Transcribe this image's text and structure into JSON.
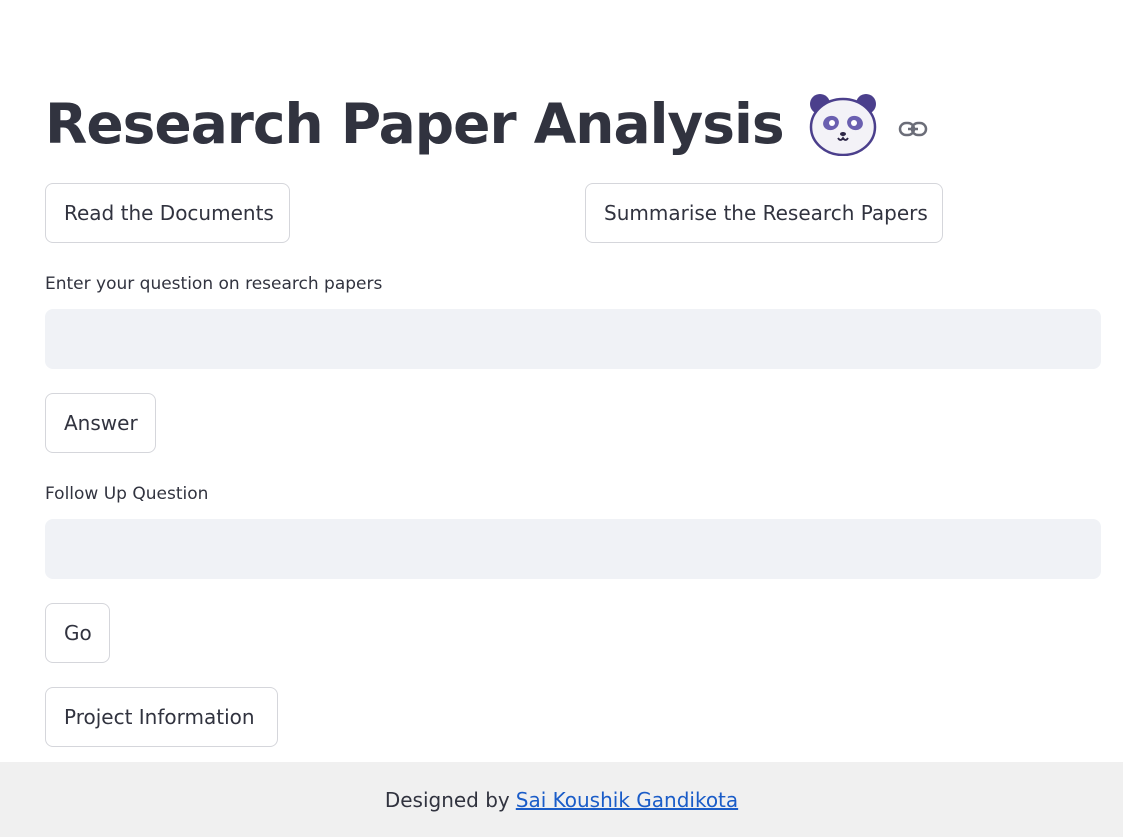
{
  "header": {
    "title": "Research Paper Analysis",
    "emoji_icon": "panda-icon",
    "anchor_icon": "link-icon"
  },
  "actions": {
    "read_documents": "Read the Documents",
    "summarise": "Summarise the Research Papers"
  },
  "question": {
    "label": "Enter your question on research papers",
    "value": "",
    "placeholder": "",
    "answer_button": "Answer"
  },
  "follow_up": {
    "label": "Follow Up Question",
    "value": "",
    "placeholder": "",
    "go_button": "Go"
  },
  "project_info_button": "Project Information",
  "footer": {
    "prefix": "Designed by",
    "author_link": "Sai Koushik Gandikota"
  },
  "colors": {
    "text": "#31333f",
    "input_bg": "#f0f2f6",
    "footer_bg": "#f0f0f0",
    "link": "#1a5cc8",
    "panda_accent": "#4b3f8c"
  }
}
